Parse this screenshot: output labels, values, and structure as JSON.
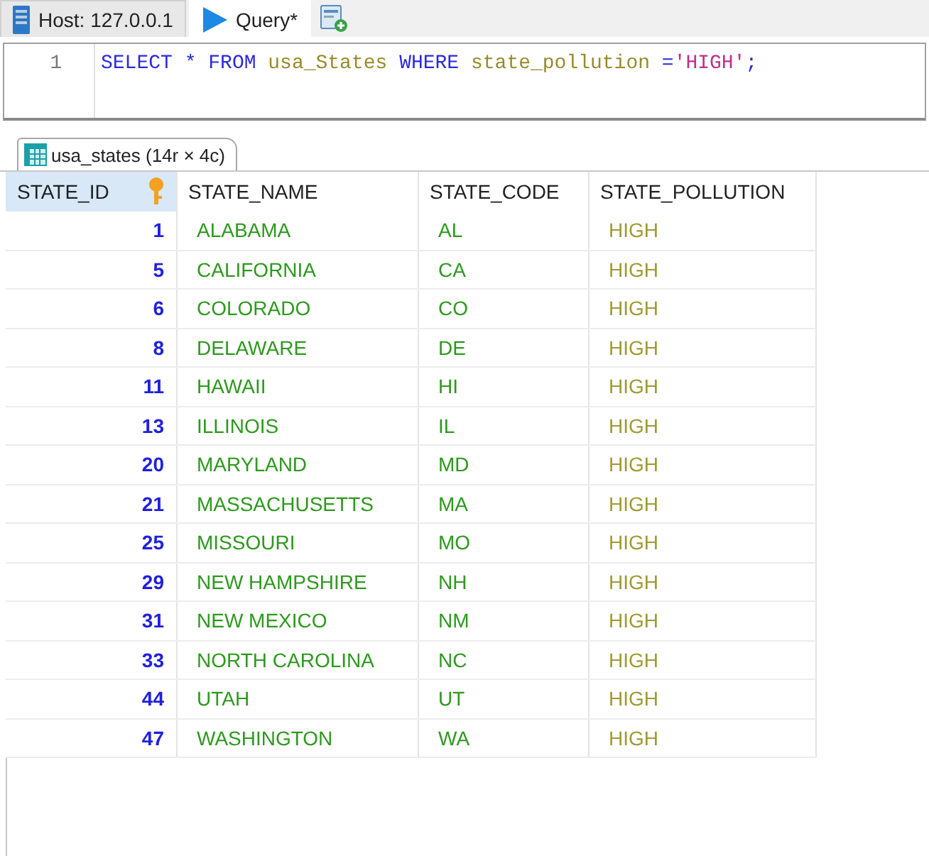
{
  "tabs": [
    {
      "label": "Host: 127.0.0.1",
      "kind": "host",
      "selected": false
    },
    {
      "label": "Query*",
      "kind": "query",
      "selected": true
    }
  ],
  "editor": {
    "lines": [
      {
        "number": "1",
        "tokens": [
          {
            "text": "SELECT",
            "kind": "keyword"
          },
          {
            "text": " * ",
            "kind": "keyword"
          },
          {
            "text": "FROM",
            "kind": "keyword"
          },
          {
            "text": " usa_States ",
            "kind": "identifier"
          },
          {
            "text": "WHERE",
            "kind": "keyword"
          },
          {
            "text": " state_pollution ",
            "kind": "identifier"
          },
          {
            "text": "=",
            "kind": "operator"
          },
          {
            "text": "'HIGH'",
            "kind": "string"
          },
          {
            "text": ";",
            "kind": "operator"
          }
        ]
      }
    ]
  },
  "result_tab": {
    "label": "usa_states (14r × 4c)",
    "selected": true
  },
  "table": {
    "columns": [
      {
        "label": "STATE_ID",
        "kind": "number",
        "primary_key": true,
        "selected": true
      },
      {
        "label": "STATE_NAME",
        "kind": "text",
        "primary_key": false,
        "selected": false
      },
      {
        "label": "STATE_CODE",
        "kind": "text",
        "primary_key": false,
        "selected": false
      },
      {
        "label": "STATE_POLLUTION",
        "kind": "enum",
        "primary_key": false,
        "selected": false
      }
    ],
    "rows": [
      [
        "1",
        "ALABAMA",
        "AL",
        "HIGH"
      ],
      [
        "5",
        "CALIFORNIA",
        "CA",
        "HIGH"
      ],
      [
        "6",
        "COLORADO",
        "CO",
        "HIGH"
      ],
      [
        "8",
        "DELAWARE",
        "DE",
        "HIGH"
      ],
      [
        "11",
        "HAWAII",
        "HI",
        "HIGH"
      ],
      [
        "13",
        "ILLINOIS",
        "IL",
        "HIGH"
      ],
      [
        "20",
        "MARYLAND",
        "MD",
        "HIGH"
      ],
      [
        "21",
        "MASSACHUSETTS",
        "MA",
        "HIGH"
      ],
      [
        "25",
        "MISSOURI",
        "MO",
        "HIGH"
      ],
      [
        "29",
        "NEW HAMPSHIRE",
        "NH",
        "HIGH"
      ],
      [
        "31",
        "NEW MEXICO",
        "NM",
        "HIGH"
      ],
      [
        "33",
        "NORTH CAROLINA",
        "NC",
        "HIGH"
      ],
      [
        "44",
        "UTAH",
        "UT",
        "HIGH"
      ],
      [
        "47",
        "WASHINGTON",
        "WA",
        "HIGH"
      ]
    ]
  }
}
